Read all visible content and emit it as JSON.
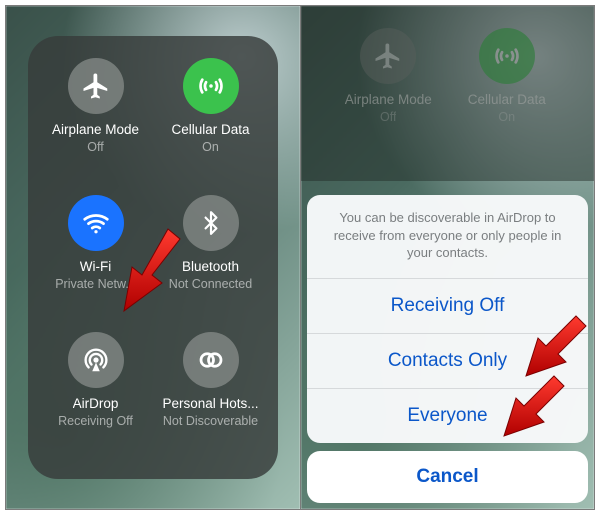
{
  "left": {
    "airplane": {
      "label": "Airplane Mode",
      "status": "Off"
    },
    "cellular": {
      "label": "Cellular Data",
      "status": "On"
    },
    "wifi": {
      "label": "Wi-Fi",
      "status": "Private Netw..."
    },
    "bt": {
      "label": "Bluetooth",
      "status": "Not Connected"
    },
    "airdrop": {
      "label": "AirDrop",
      "status": "Receiving Off"
    },
    "hotspot": {
      "label": "Personal Hots...",
      "status": "Not Discoverable"
    }
  },
  "right": {
    "airplane": {
      "label": "Airplane Mode",
      "status": "Off"
    },
    "cellular": {
      "label": "Cellular Data",
      "status": "On"
    },
    "sheet": {
      "message": "You can be discoverable in AirDrop to receive from everyone or only people in your contacts.",
      "opt_off": "Receiving Off",
      "opt_contacts": "Contacts Only",
      "opt_everyone": "Everyone",
      "cancel": "Cancel"
    }
  },
  "colors": {
    "green": "#3bc24d",
    "blue": "#1a73ff",
    "grey": "rgba(135,140,138,0.75)",
    "link": "#0b57c9"
  }
}
